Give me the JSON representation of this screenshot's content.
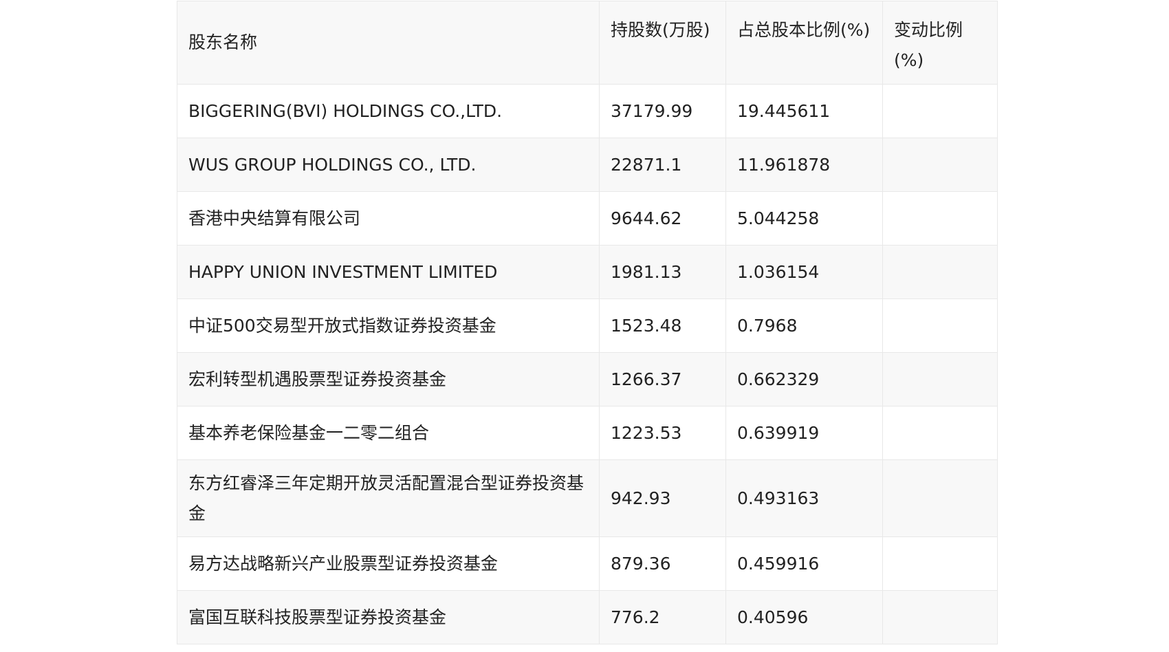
{
  "table": {
    "headers": [
      "股东名称",
      "持股数(万股)",
      "占总股本比例(%)",
      "变动比例(%)"
    ],
    "rows": [
      [
        "BIGGERING(BVI) HOLDINGS CO.,LTD.",
        "37179.99",
        "19.445611",
        ""
      ],
      [
        "WUS GROUP HOLDINGS CO., LTD.",
        "22871.1",
        "11.961878",
        ""
      ],
      [
        "香港中央结算有限公司",
        "9644.62",
        "5.044258",
        ""
      ],
      [
        "HAPPY UNION INVESTMENT LIMITED",
        "1981.13",
        "1.036154",
        ""
      ],
      [
        "中证500交易型开放式指数证券投资基金",
        "1523.48",
        "0.7968",
        ""
      ],
      [
        "宏利转型机遇股票型证券投资基金",
        "1266.37",
        "0.662329",
        ""
      ],
      [
        "基本养老保险基金一二零二组合",
        "1223.53",
        "0.639919",
        ""
      ],
      [
        "东方红睿泽三年定期开放灵活配置混合型证券投资基金",
        "942.93",
        "0.493163",
        ""
      ],
      [
        "易方达战略新兴产业股票型证券投资基金",
        "879.36",
        "0.459916",
        ""
      ],
      [
        "富国互联科技股票型证券投资基金",
        "776.2",
        "0.40596",
        ""
      ]
    ]
  }
}
